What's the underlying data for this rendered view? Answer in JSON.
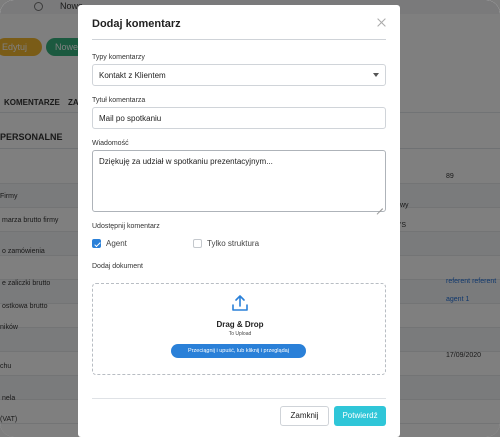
{
  "background": {
    "top_text": "Nowe",
    "buttons": {
      "edit": "Edytuj",
      "new": "Nowe"
    },
    "tabs": [
      "KOMENTARZE",
      "ZA"
    ],
    "section_title": "PERSONALNE",
    "rows_left": [
      "Firmy",
      "marza brutto firmy",
      "o zamówienia",
      "e zaliczki brutto",
      "ostkowa brutto",
      "ników",
      "chu",
      "nela",
      "(VAT)"
    ],
    "rows_right": [
      "89",
      "wy",
      "'S",
      "referent referent",
      "agent 1",
      "17/09/2020"
    ]
  },
  "modal": {
    "title": "Dodaj komentarz",
    "type_label": "Typy komentarzy",
    "type_value": "Kontakt z Klientem",
    "title_label": "Tytuł komentarza",
    "title_value": "Mail po spotkaniu",
    "message_label": "Wiadomość",
    "message_value": "Dziękuję za udział w spotkaniu prezentacyjnym...",
    "share_label": "Udostępnij komentarz",
    "share_options": [
      {
        "label": "Agent",
        "checked": true
      },
      {
        "label": "Tylko struktura",
        "checked": false
      }
    ],
    "document_label": "Dodaj dokument",
    "dropzone": {
      "icon": "upload-icon",
      "title": "Drag & Drop",
      "subtitle": "To Upload",
      "button": "Przeciągnij i upuść, lub kliknij i przeglądaj"
    },
    "footer": {
      "close": "Zamknij",
      "confirm": "Potwierdź"
    }
  },
  "colors": {
    "primary_blue": "#2a80d8",
    "confirm_teal": "#2fc6d8",
    "edit_yellow": "#f5b82e",
    "new_green": "#36b37e",
    "overlay": "rgba(0,0,0,0.5)"
  }
}
